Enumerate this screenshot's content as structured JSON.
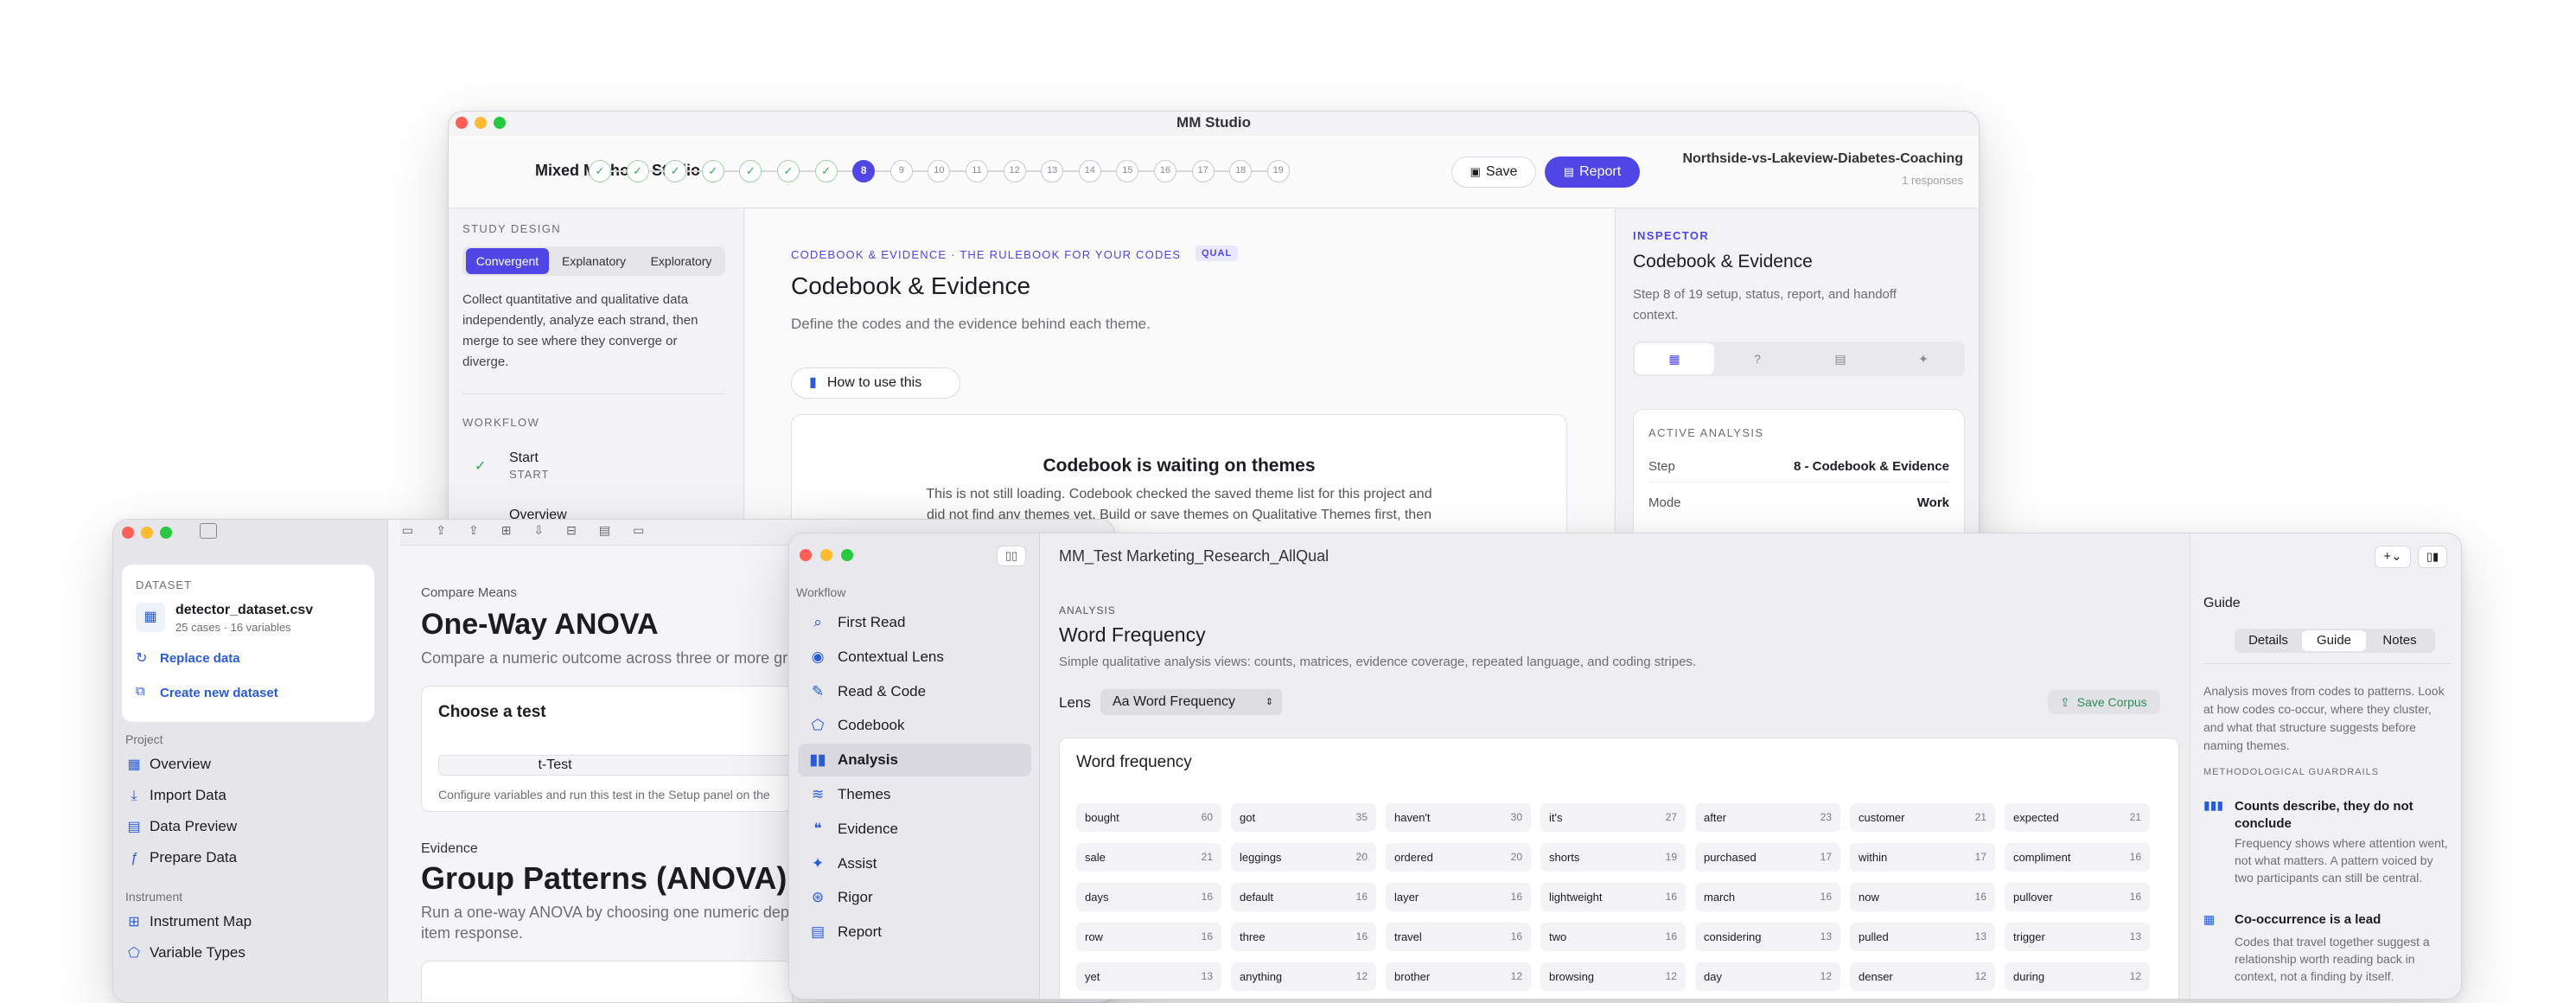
{
  "w1": {
    "title": "MM Studio",
    "app_name": "Mixed Methods Studio",
    "steps": [
      "✓",
      "✓",
      "✓",
      "✓",
      "✓",
      "✓",
      "✓",
      "8",
      "9",
      "10",
      "11",
      "12",
      "13",
      "14",
      "15",
      "16",
      "17",
      "18",
      "19"
    ],
    "save_label": "Save",
    "report_label": "Report",
    "project_name": "Northside-vs-Lakeview-Diabetes-Coaching",
    "responses": "1 responses",
    "study_design_label": "STUDY DESIGN",
    "designs": [
      "Convergent",
      "Explanatory",
      "Exploratory"
    ],
    "design_desc": "Collect quantitative and qualitative data independently, analyze each strand, then merge to see where they converge or diverge.",
    "workflow_label": "WORKFLOW",
    "workflow_items": [
      {
        "title": "Start",
        "sub": "START"
      },
      {
        "title": "Overview",
        "sub": ""
      }
    ],
    "main": {
      "eyebrow": "CODEBOOK & EVIDENCE · THE RULEBOOK FOR YOUR CODES",
      "badge": "QUAL",
      "title": "Codebook & Evidence",
      "subtitle": "Define the codes and the evidence behind each theme.",
      "how_to": "How to use this",
      "card_title": "Codebook is waiting on themes",
      "card_body_1": "This is not still loading. Codebook checked the saved theme list for this project and",
      "card_body_2": "did not find any themes yet. Build or save themes on Qualitative Themes first, then"
    },
    "inspector": {
      "label": "INSPECTOR",
      "title": "Codebook & Evidence",
      "desc": "Step 8 of 19 setup, status, report, and handoff context.",
      "active_label": "ACTIVE ANALYSIS",
      "rows": [
        {
          "key": "Step",
          "val": "8 - Codebook & Evidence"
        },
        {
          "key": "Mode",
          "val": "Work"
        }
      ]
    }
  },
  "w2": {
    "dataset_label": "DATASET",
    "file_name": "detector_dataset.csv",
    "file_meta": "25 cases · 16 variables",
    "replace": "Replace data",
    "create": "Create new dataset",
    "project_label": "Project",
    "project_items": [
      "Overview",
      "Import Data",
      "Data Preview",
      "Prepare Data"
    ],
    "instrument_label": "Instrument",
    "instrument_items": [
      "Instrument Map",
      "Variable Types"
    ],
    "eyebrow": "Compare Means",
    "title": "One-Way ANOVA",
    "desc": "Compare a numeric outcome across three or more gr",
    "choose": "Choose a test",
    "test_option": "t-Test",
    "configure": "Configure variables and run this test in the Setup panel on the",
    "evidence_label": "Evidence",
    "title2": "Group Patterns (ANOVA)",
    "desc2a": "Run a one-way ANOVA by choosing one numeric depe",
    "desc2b": "item response."
  },
  "w3": {
    "title": "MM_Test Marketing_Research_AllQual",
    "workflow_label": "Workflow",
    "nav": [
      "First Read",
      "Contextual Lens",
      "Read & Code",
      "Codebook",
      "Analysis",
      "Themes",
      "Evidence",
      "Assist",
      "Rigor",
      "Report"
    ],
    "nav_icons": [
      "⌕",
      "◉",
      "✎",
      "⬠",
      "▮▮",
      "≋",
      "❝",
      "✦",
      "⊛",
      "▤"
    ],
    "analysis_label": "ANALYSIS",
    "heading": "Word Frequency",
    "sub": "Simple qualitative analysis views: counts, matrices, evidence coverage, repeated language, and coding stripes.",
    "lens_label": "Lens",
    "lens_value": "Aa Word Frequency",
    "save_corpus": "Save Corpus",
    "card_title": "Word frequency",
    "words": [
      [
        "bought",
        "60"
      ],
      [
        "got",
        "35"
      ],
      [
        "haven't",
        "30"
      ],
      [
        "it's",
        "27"
      ],
      [
        "after",
        "23"
      ],
      [
        "customer",
        "21"
      ],
      [
        "expected",
        "21"
      ],
      [
        "sale",
        "21"
      ],
      [
        "leggings",
        "20"
      ],
      [
        "ordered",
        "20"
      ],
      [
        "shorts",
        "19"
      ],
      [
        "purchased",
        "17"
      ],
      [
        "within",
        "17"
      ],
      [
        "compliment",
        "16"
      ],
      [
        "days",
        "16"
      ],
      [
        "default",
        "16"
      ],
      [
        "layer",
        "16"
      ],
      [
        "lightweight",
        "16"
      ],
      [
        "march",
        "16"
      ],
      [
        "now",
        "16"
      ],
      [
        "pullover",
        "16"
      ],
      [
        "row",
        "16"
      ],
      [
        "three",
        "16"
      ],
      [
        "travel",
        "16"
      ],
      [
        "two",
        "16"
      ],
      [
        "considering",
        "13"
      ],
      [
        "pulled",
        "13"
      ],
      [
        "trigger",
        "13"
      ],
      [
        "yet",
        "13"
      ],
      [
        "anything",
        "12"
      ],
      [
        "brother",
        "12"
      ],
      [
        "browsing",
        "12"
      ],
      [
        "day",
        "12"
      ],
      [
        "denser",
        "12"
      ],
      [
        "during",
        "12"
      ]
    ],
    "right_label": "Guide",
    "tabs": [
      "Details",
      "Guide",
      "Notes"
    ],
    "guide_text": "Analysis moves from codes to patterns. Look at how codes co-occur, where they cluster, and what that structure suggests before naming themes.",
    "guardrails_label": "METHODOLOGICAL GUARDRAILS",
    "guardrails": [
      {
        "title": "Counts describe, they do not conclude",
        "body": "Frequency shows where attention went, not what matters. A pattern voiced by two participants can still be central."
      },
      {
        "title": "Co-occurrence is a lead",
        "body": "Codes that travel together suggest a relationship worth reading back in context, not a finding by itself."
      }
    ]
  },
  "colors": {
    "accent": "#5046e5",
    "link": "#2a5bd7",
    "green": "#34a853"
  }
}
